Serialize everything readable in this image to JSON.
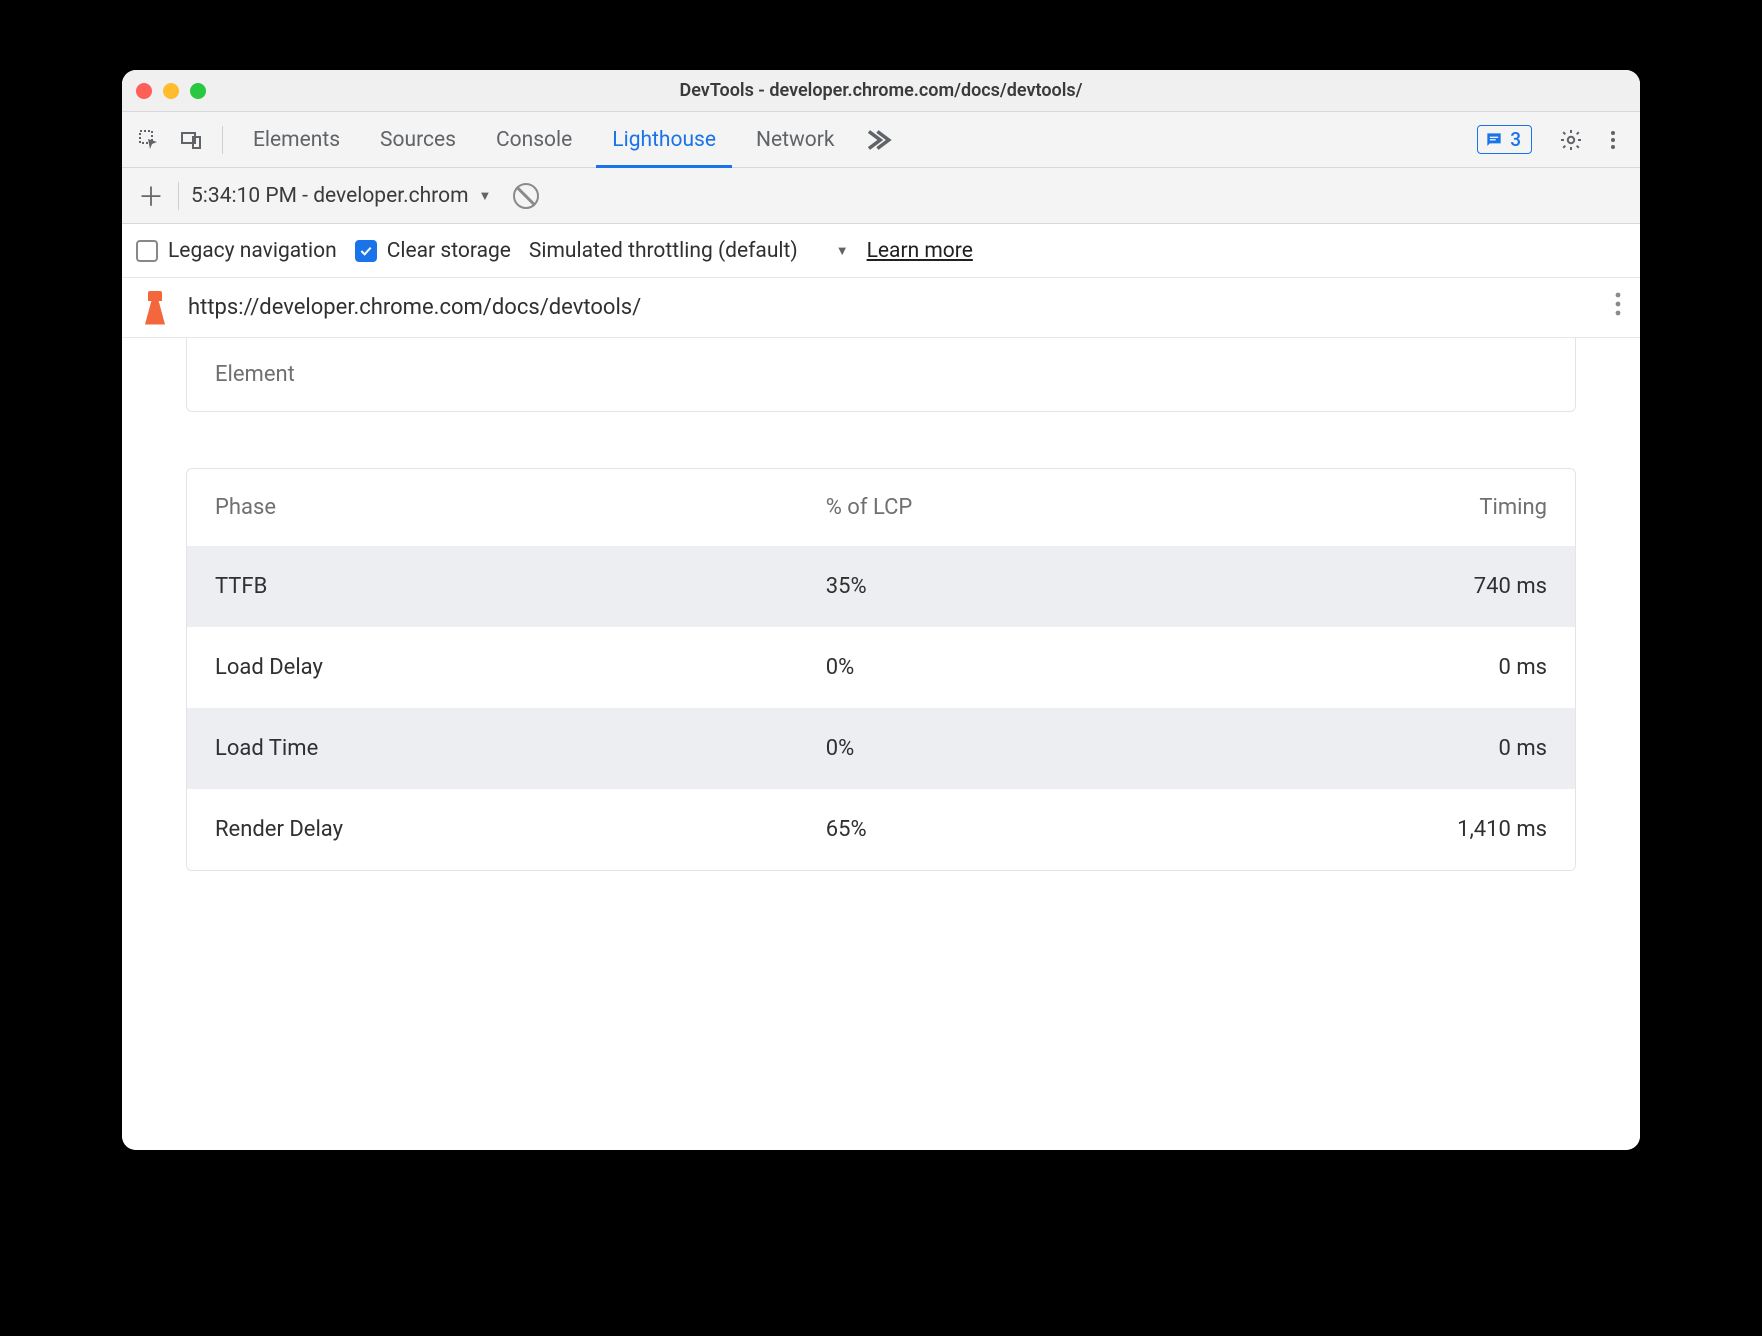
{
  "window": {
    "title": "DevTools - developer.chrome.com/docs/devtools/"
  },
  "tabs": {
    "items": [
      "Elements",
      "Sources",
      "Console",
      "Lighthouse",
      "Network"
    ],
    "active_index": 3,
    "messages_count": "3"
  },
  "secondary": {
    "run_label": "5:34:10 PM - developer.chrom"
  },
  "options": {
    "legacy_label": "Legacy navigation",
    "legacy_checked": false,
    "clear_label": "Clear storage",
    "clear_checked": true,
    "throttling_label": "Simulated throttling (default)",
    "learn_more": "Learn more"
  },
  "report": {
    "url": "https://developer.chrome.com/docs/devtools/",
    "element_section_label": "Element",
    "phase_table": {
      "headers": {
        "phase": "Phase",
        "pct": "% of LCP",
        "timing": "Timing"
      },
      "rows": [
        {
          "phase": "TTFB",
          "pct": "35%",
          "timing": "740 ms"
        },
        {
          "phase": "Load Delay",
          "pct": "0%",
          "timing": "0 ms"
        },
        {
          "phase": "Load Time",
          "pct": "0%",
          "timing": "0 ms"
        },
        {
          "phase": "Render Delay",
          "pct": "65%",
          "timing": "1,410 ms"
        }
      ]
    }
  }
}
